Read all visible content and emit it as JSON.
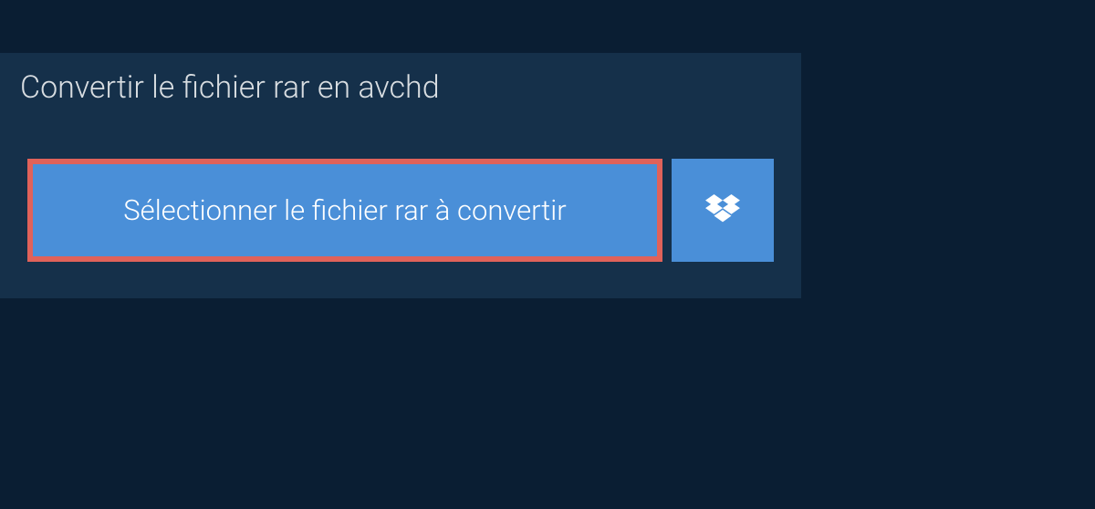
{
  "header": {
    "title": "Convertir le fichier rar en avchd"
  },
  "actions": {
    "select_file_label": "Sélectionner le fichier rar à convertir",
    "dropbox_icon_name": "dropbox-icon"
  },
  "colors": {
    "page_bg": "#0a1e33",
    "panel_bg": "#15304a",
    "button_bg": "#4a8fd8",
    "highlight_border": "#e0625a",
    "text_light": "#d8dde1",
    "text_white": "#ffffff"
  }
}
